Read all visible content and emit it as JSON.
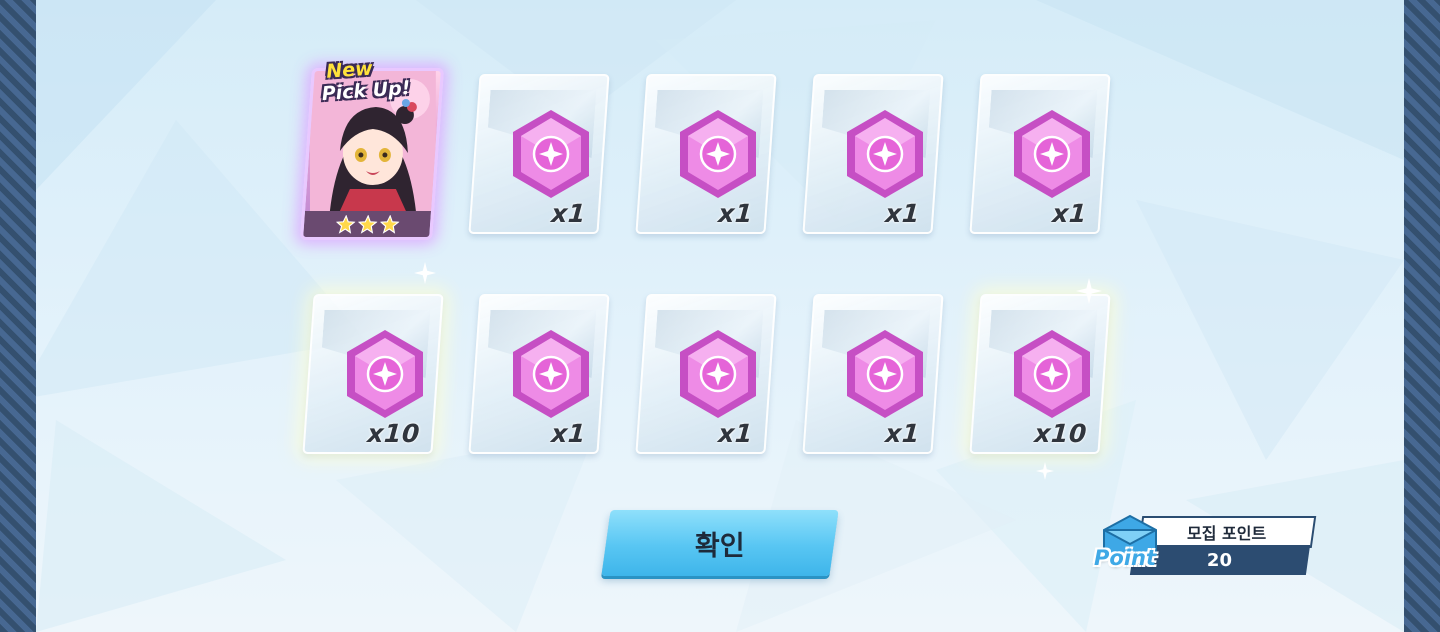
{
  "featured_card": {
    "badge_line1": "New",
    "badge_line2": "Pick Up!",
    "stars": 3,
    "icon": "character-portrait"
  },
  "rewards_row1": [
    {
      "icon": "pink-hexagon-gem-icon",
      "qty": "x1"
    },
    {
      "icon": "pink-hexagon-gem-icon",
      "qty": "x1"
    },
    {
      "icon": "pink-hexagon-gem-icon",
      "qty": "x1"
    },
    {
      "icon": "pink-hexagon-gem-icon",
      "qty": "x1"
    }
  ],
  "rewards_row2": [
    {
      "icon": "pink-hexagon-gem-icon",
      "qty": "x10"
    },
    {
      "icon": "pink-hexagon-gem-icon",
      "qty": "x1"
    },
    {
      "icon": "pink-hexagon-gem-icon",
      "qty": "x1"
    },
    {
      "icon": "pink-hexagon-gem-icon",
      "qty": "x1"
    },
    {
      "icon": "pink-hexagon-gem-icon",
      "qty": "x10"
    }
  ],
  "confirm_button": {
    "label": "확인"
  },
  "recruit_points": {
    "title": "모집 포인트",
    "value": "20",
    "tag": "Point",
    "icon": "envelope-icon"
  },
  "colors": {
    "accent": "#58c6f3",
    "gem": "#e070d8",
    "panel_dark": "#2c4c71"
  }
}
